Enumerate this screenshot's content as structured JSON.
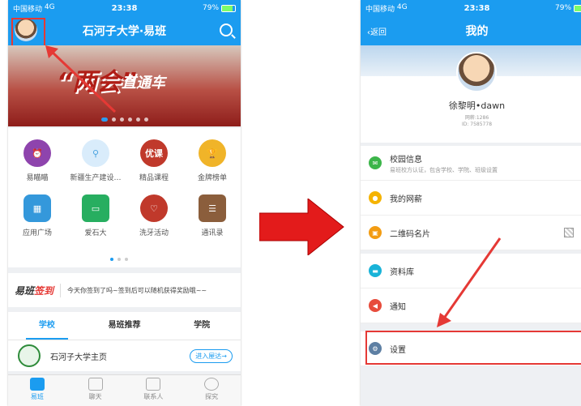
{
  "colors": {
    "accent": "#1b9cf0",
    "annotation": "#e53935"
  },
  "left_phone": {
    "status": {
      "carrier": "中国移动",
      "network": "4G",
      "time": "23:38",
      "battery": "79%"
    },
    "title": "石河子大学·易班",
    "banner": {
      "headline": "“两会”",
      "headline2": "直通车"
    },
    "apps": [
      {
        "label": "易瞄瞄",
        "icon": "alarm-clock-icon",
        "color": "#8e44ad"
      },
      {
        "label": "新疆生产建设…",
        "icon": "person-icon",
        "color": "#4aa3e0"
      },
      {
        "label": "精品课程",
        "icon": "yooc-icon",
        "icon_text": "优课",
        "color": "#c0392b"
      },
      {
        "label": "金牌榜单",
        "icon": "trophy-icon",
        "color": "#f0b429"
      },
      {
        "label": "应用广场",
        "icon": "grid-icon",
        "color": "#3498db"
      },
      {
        "label": "爱石大",
        "icon": "blackboard-icon",
        "color": "#27ae60"
      },
      {
        "label": "洗牙活动",
        "icon": "tooth-icon",
        "color": "#c0392b"
      },
      {
        "label": "通讯录",
        "icon": "contacts-book-icon",
        "color": "#8b5e3c"
      }
    ],
    "signin": {
      "logo_a": "易班",
      "logo_b": "签到",
      "text": "今天你签到了吗~签到后可以随机获得奖励哦~~"
    },
    "tabs": [
      "学校",
      "易班推荐",
      "学院"
    ],
    "school": {
      "name": "石河子大学主页",
      "enter": "进入屋达→"
    },
    "bottom_nav": [
      "易班",
      "聊天",
      "联系人",
      "探究"
    ]
  },
  "right_phone": {
    "status": {
      "carrier": "中国移动",
      "network": "4G",
      "time": "23:38",
      "battery": "79%"
    },
    "back": "返回",
    "title": "我的",
    "profile": {
      "name": "徐黎明•dawn",
      "wealth": "网薪:1286",
      "id": "ID: 7585778"
    },
    "menu": [
      {
        "title": "校园信息",
        "sub": "易班校方认证，包含学校、学院、班级设置",
        "icon": "message-icon",
        "color": "#3cb54a"
      },
      {
        "title": "我的网薪",
        "sub": "",
        "icon": "coins-icon",
        "color": "#f5b301"
      },
      {
        "title": "二维码名片",
        "sub": "",
        "icon": "card-icon",
        "color": "#f39c12"
      },
      {
        "title": "资料库",
        "sub": "",
        "icon": "library-icon",
        "color": "#19b3d8"
      },
      {
        "title": "通知",
        "sub": "",
        "icon": "speaker-icon",
        "color": "#e74c3c"
      },
      {
        "title": "设置",
        "sub": "",
        "icon": "gear-icon",
        "color": "#5d7fa3"
      }
    ]
  }
}
